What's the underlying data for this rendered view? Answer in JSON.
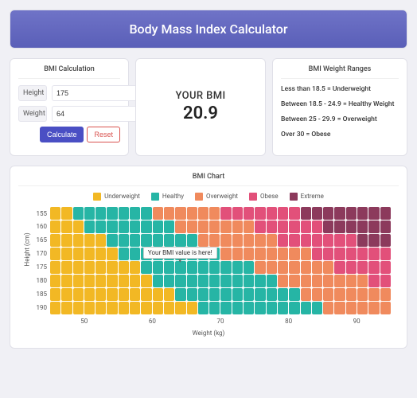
{
  "header": {
    "title": "Body Mass Index Calculator"
  },
  "calc": {
    "title": "BMI Calculation",
    "height_label": "Height",
    "height_value": "175",
    "weight_label": "Weight",
    "weight_value": "64",
    "calculate": "Calculate",
    "reset": "Reset"
  },
  "result": {
    "label": "YOUR BMI",
    "value": "20.9"
  },
  "ranges": {
    "title": "BMI Weight Ranges",
    "r0": "Less than 18.5 = Underweight",
    "r1": "Between 18.5 - 24.9 = Healthy Weight",
    "r2": "Between 25 - 29.9 = Overweight",
    "r3": "Over 30 = Obese"
  },
  "chart": {
    "title": "BMI Chart",
    "legend": {
      "under": "Underweight",
      "healthy": "Healthy",
      "over": "Overweight",
      "obese": "Obese",
      "extreme": "Extreme"
    },
    "ylabel": "Height (cm)",
    "xlabel": "Weight (kg)",
    "tooltip": "Your BMI value is here!",
    "xticks": {
      "t0": "50",
      "t1": "60",
      "t2": "70",
      "t3": "80",
      "t4": "90"
    },
    "yticks": {
      "t0": "155",
      "t1": "160",
      "t2": "165",
      "t3": "170",
      "t4": "175",
      "t5": "180",
      "t6": "185",
      "t7": "190"
    }
  },
  "chart_data": {
    "type": "heatmap",
    "title": "BMI Chart",
    "xlabel": "Weight (kg)",
    "ylabel": "Height (cm)",
    "x_range_kg": [
      42,
      100,
      2
    ],
    "y_range_cm": [
      155,
      190,
      5
    ],
    "marker_point": {
      "height_cm": 175,
      "weight_kg": 64,
      "bmi": 20.9
    },
    "thresholds": {
      "underweight_lt": 18.5,
      "healthy_lt": 24.9,
      "overweight_lt": 29.9,
      "obese_lt": 35
    },
    "colors": {
      "underweight": "#f2b824",
      "healthy": "#26b5a5",
      "overweight": "#f08a5d",
      "obese": "#e2507a",
      "extreme": "#8c3a5c"
    }
  }
}
